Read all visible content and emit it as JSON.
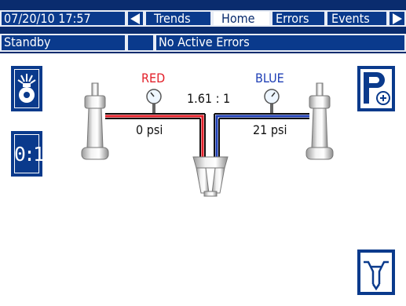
{
  "header": {
    "datetime": "07/20/10 17:57",
    "tabs": [
      "Trends",
      "Home",
      "Errors",
      "Events"
    ],
    "active_tab": "Home",
    "status": "Standby",
    "errors": "No Active Errors"
  },
  "main": {
    "left_label": "RED",
    "right_label": "BLUE",
    "ratio": "1.61 : 1",
    "left_pressure": "0 psi",
    "right_pressure": "21 psi",
    "ratio_button": "0:1"
  },
  "colors": {
    "bar": "#0a2c6e",
    "accent": "#0a3a8c",
    "red_line": "#e3202a",
    "blue_line": "#1f3fb5"
  },
  "icons": {
    "left_arrow": "left-arrow-icon",
    "right_arrow": "right-arrow-icon",
    "pump": "pump-icon",
    "park": "park-icon",
    "mix": "mix-icon",
    "gauge": "gauge-icon",
    "cylinder": "cylinder-icon",
    "manifold": "manifold-icon"
  }
}
